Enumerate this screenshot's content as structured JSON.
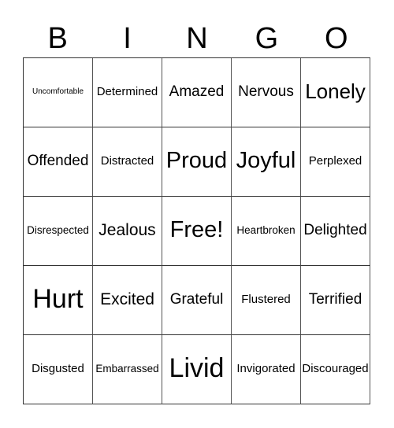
{
  "header": {
    "letters": [
      "B",
      "I",
      "N",
      "G",
      "O"
    ]
  },
  "cells": [
    [
      "Uncomfortable",
      "Determined",
      "Amazed",
      "Nervous",
      "Lonely"
    ],
    [
      "Offended",
      "Distracted",
      "Proud",
      "Joyful",
      "Perplexed"
    ],
    [
      "Disrespected",
      "Jealous",
      "Free!",
      "Heartbroken",
      "Delighted"
    ],
    [
      "Hurt",
      "Excited",
      "Grateful",
      "Flustered",
      "Terrified"
    ],
    [
      "Disgusted",
      "Embarrassed",
      "Livid",
      "Invigorated",
      "Discouraged"
    ]
  ]
}
